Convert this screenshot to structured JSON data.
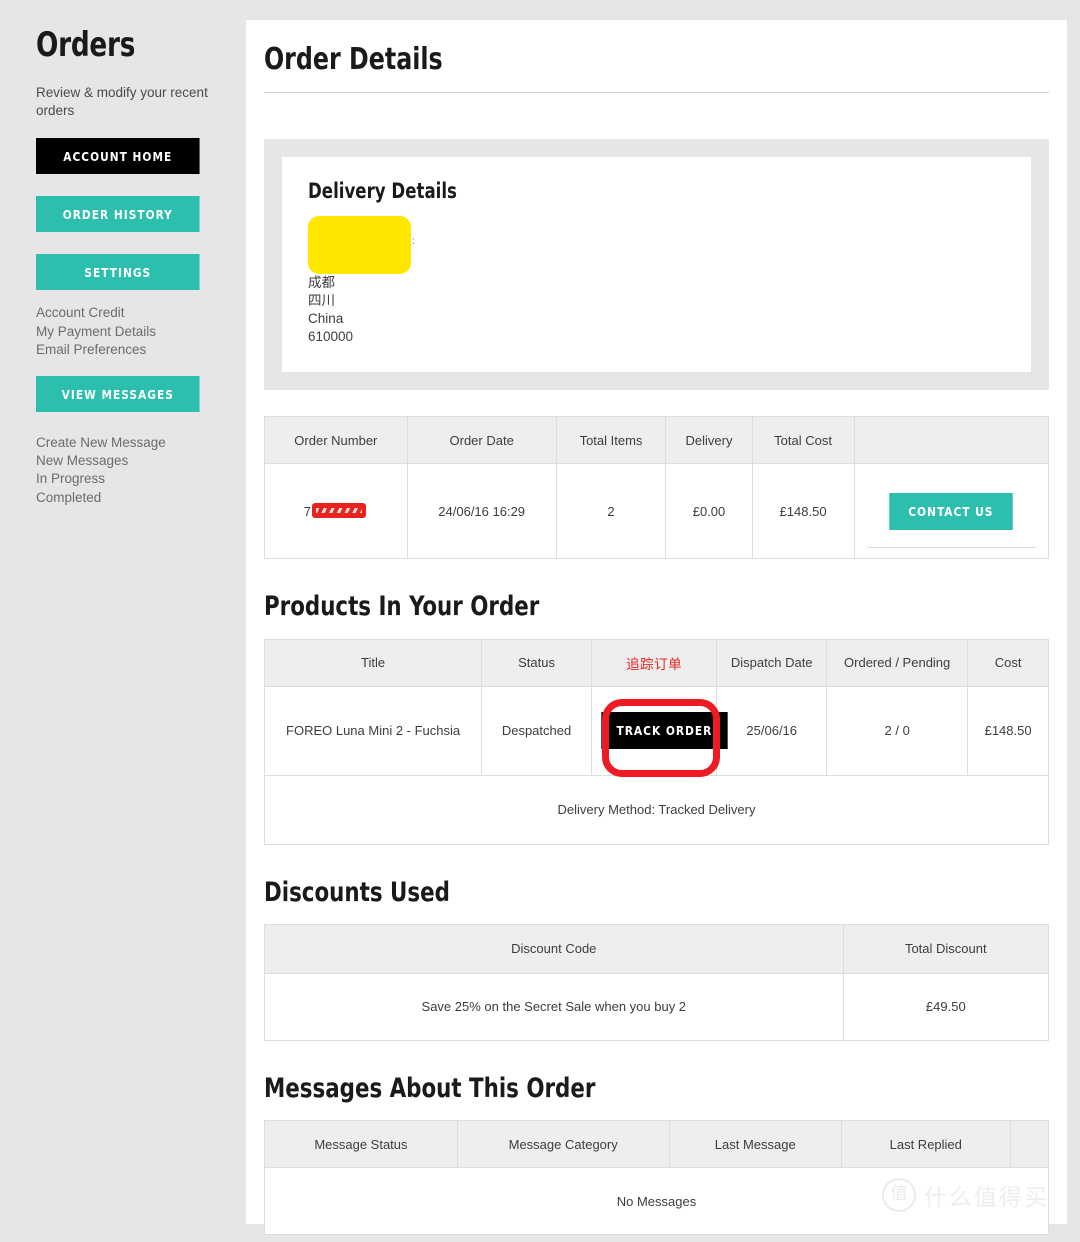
{
  "sidebar": {
    "title": "Orders",
    "subtitle": "Review & modify your recent orders",
    "buttons": [
      {
        "label": "ACCOUNT HOME",
        "style": "dark"
      },
      {
        "label": "ORDER HISTORY",
        "style": "teal"
      },
      {
        "label": "SETTINGS",
        "style": "teal"
      }
    ],
    "account_links": [
      "Account Credit",
      "My Payment Details",
      "Email Preferences"
    ],
    "messages_button": "VIEW MESSAGES",
    "message_links": [
      "Create New Message",
      "New Messages",
      "In Progress",
      "Completed"
    ]
  },
  "main": {
    "page_title": "Order Details",
    "delivery": {
      "heading": "Delivery Details",
      "address_lines": [
        "成都",
        "四川",
        "China",
        "610000"
      ],
      "redacted_note": "name-and-street-redacted"
    },
    "order_summary": {
      "headers": [
        "Order Number",
        "Order Date",
        "Total Items",
        "Delivery",
        "Total Cost",
        ""
      ],
      "row": {
        "order_number_prefix": "7",
        "order_number_redacted": true,
        "order_date": "24/06/16 16:29",
        "total_items": "2",
        "delivery": "£0.00",
        "total_cost": "£148.50",
        "action_label": "CONTACT US"
      }
    },
    "products": {
      "heading": "Products In Your Order",
      "headers": [
        "Title",
        "Status",
        "",
        "Dispatch Date",
        "Ordered / Pending",
        "Cost"
      ],
      "annotation_label": "追踪订单",
      "row": {
        "title": "FOREO Luna Mini 2 - Fuchsia",
        "status": "Despatched",
        "track_label": "TRACK ORDER",
        "dispatch_date": "25/06/16",
        "ordered_pending": "2 / 0",
        "cost": "£148.50"
      },
      "delivery_method": "Delivery Method: Tracked Delivery"
    },
    "discounts": {
      "heading": "Discounts Used",
      "headers": [
        "Discount Code",
        "Total Discount"
      ],
      "row": {
        "code": "Save 25% on the Secret Sale when you buy 2",
        "total": "£49.50"
      }
    },
    "messages": {
      "heading": "Messages About This Order",
      "headers": [
        "Message Status",
        "Message Category",
        "Last Message",
        "Last Replied",
        ""
      ],
      "empty_text": "No Messages"
    }
  },
  "watermark": {
    "mark": "值",
    "text": "什么值得买"
  },
  "colors": {
    "teal": "#2dbfae",
    "dark": "#000000",
    "annotation_red": "#ed1c24",
    "redaction_yellow": "#ffe700",
    "page_gray": "#e6e6e6"
  }
}
